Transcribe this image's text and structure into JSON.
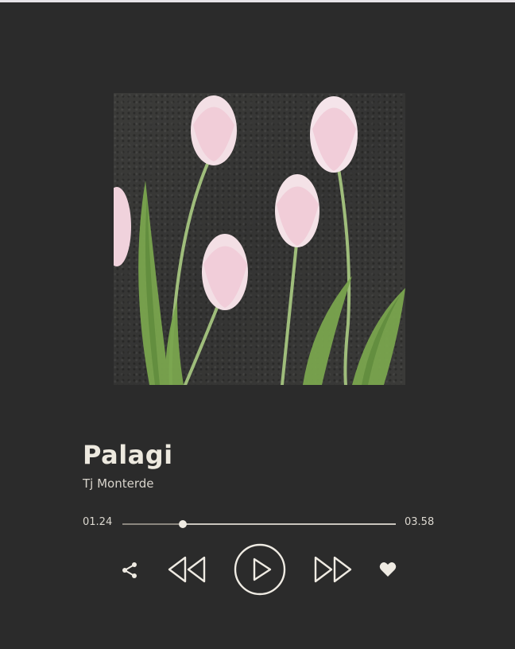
{
  "track": {
    "title": "Palagi",
    "artist": "Tj Monterde"
  },
  "playback": {
    "elapsed": "01.24",
    "duration": "03.58",
    "progress": 0.22
  },
  "controls": {
    "share_icon": "share-icon",
    "previous_icon": "rewind-icon",
    "play_icon": "play-icon",
    "next_icon": "fast-forward-icon",
    "like_icon": "heart-icon"
  },
  "cover": {
    "subject": "pink tulips on dark fabric"
  },
  "colors": {
    "background": "#2b2b2b",
    "text": "#ede9df",
    "accent": "#efebe3"
  }
}
